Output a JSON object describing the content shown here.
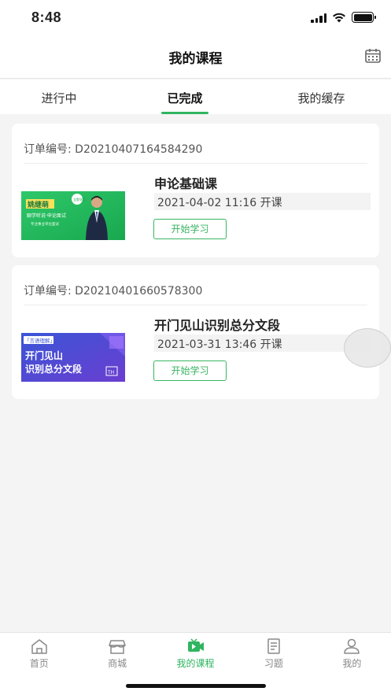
{
  "status": {
    "time": "8:48"
  },
  "nav": {
    "title": "我的课程"
  },
  "tabs": [
    {
      "label": "进行中",
      "active": false
    },
    {
      "label": "已完成",
      "active": true
    },
    {
      "label": "我的缓存",
      "active": false
    }
  ],
  "orders": [
    {
      "order_label": "订单编号: D20210407164584290",
      "course_title": "申论基础课",
      "start_time": "2021-04-02 11:16 开课",
      "button": "开始学习",
      "thumb": {
        "name": "姚继萌",
        "tag": "立即学习",
        "line1": "聊学听说·申论面试",
        "line2": "专注事业单位面试"
      }
    },
    {
      "order_label": "订单编号: D20210401660578300",
      "course_title": "开门见山识别总分文段",
      "start_time": "2021-03-31 13:46 开课",
      "button": "开始学习",
      "thumb": {
        "tag": "「言语理解」",
        "line1": "开门见山",
        "line2": "识别总分文段",
        "badge": "TH"
      }
    }
  ],
  "bottom_nav": [
    {
      "label": "首页",
      "icon": "home-icon",
      "active": false
    },
    {
      "label": "商城",
      "icon": "store-icon",
      "active": false
    },
    {
      "label": "我的课程",
      "icon": "video-course-icon",
      "active": true
    },
    {
      "label": "习题",
      "icon": "exercise-icon",
      "active": false
    },
    {
      "label": "我的",
      "icon": "profile-icon",
      "active": false
    }
  ],
  "colors": {
    "accent": "#2fb560",
    "bg": "#f4f4f4"
  }
}
